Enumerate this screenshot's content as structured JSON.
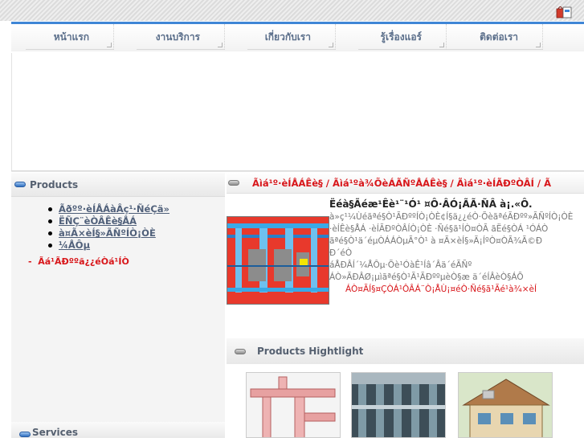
{
  "nav": {
    "items": [
      {
        "label": "หน้าแรก"
      },
      {
        "label": "งานบริการ"
      },
      {
        "label": "เกี่ยวกับเรา"
      },
      {
        "label": "รู้เรื่องแอร์"
      },
      {
        "label": "ติดต่อเรา"
      }
    ]
  },
  "sidebar": {
    "products_title": "Products",
    "items": [
      {
        "label": "Ãðºº·èÍÅÁàÂç¹·ÑéÇä»"
      },
      {
        "label": "ËÑÇ¨èÒÂÊè§ÅÁ"
      },
      {
        "label": "à¤Ã×èÍ§»ÃÑºÍÒ¡ÒÈ"
      },
      {
        "label": "¼ÅÔµ"
      }
    ],
    "sub_link": "Ãá¹ÃÐººã¿¿éÒá¹ÍÒ",
    "services_title": "Services"
  },
  "main": {
    "breadcrumb": "Ãìá¹º·èÍÅÁÊè§ / Ãìá¹ºà¾ÕèÁÃÑºÅÁÊè§ / Ãìá¹º·èÍÃÐºÒÂÍ / Ã",
    "headline": "Ëéà§Ãéæ¹Êè¹¨¹Ó¹ ¤Ô·ÂÓ¡ÃÃ·ÑÂ à¡.«Ô.",
    "description_lines": [
      "à»ç¹¼Ùéãªé§Ò¹ÃÐººÍÒ¡ÒÈ¢Í§ä¿¿éÒ·ÕèãªéÃÐºº»ÃÑºÍÒ¡ÒÈ",
      "·èÍÊè§ÅÁ ·èÍÃÐºÒÂÍÒ¡ÒÈ ·Ñé§ã¹ÍÒ¤ÒÃ ãËé§ÒÁ ¹ÓÁÒ",
      "ãªé§Ò¹ä´éµÒÁÁÒµÃ°Ò¹ à ¤Ã×èÍ§»Ã¡ÍºÒ¤ÒÃ¾Ã©Ð",
      "Ð´éÒ",
      "áÅÐÂÍ´¼ÅÔµ·Õè¹ÓàÊ¹Íâ´Âä´éÃÑº",
      "ÁÒ»ÃÐÂØ¡µìãªé§Ò¹Ã¹ÃÐººµèÒ§æ ä´éÍÂèÒ§ÁÕ"
    ],
    "description_red": "ÁÒ¤ÃÍ§¤ÇÒÁ¹ÔÂÁ¨Ò¡ÅÙ¡¤éÒ·Ñé§ã¹Ãé¹à¾×èÍ",
    "highlight_title": "Products Hightlight"
  },
  "colors": {
    "accent_blue": "#3f86d6",
    "link_red": "#d8161a",
    "nav_text": "#5a6e8a"
  },
  "icons": {
    "top_right": "shopping-bag-icon",
    "section": "pill-bullet-icon"
  }
}
